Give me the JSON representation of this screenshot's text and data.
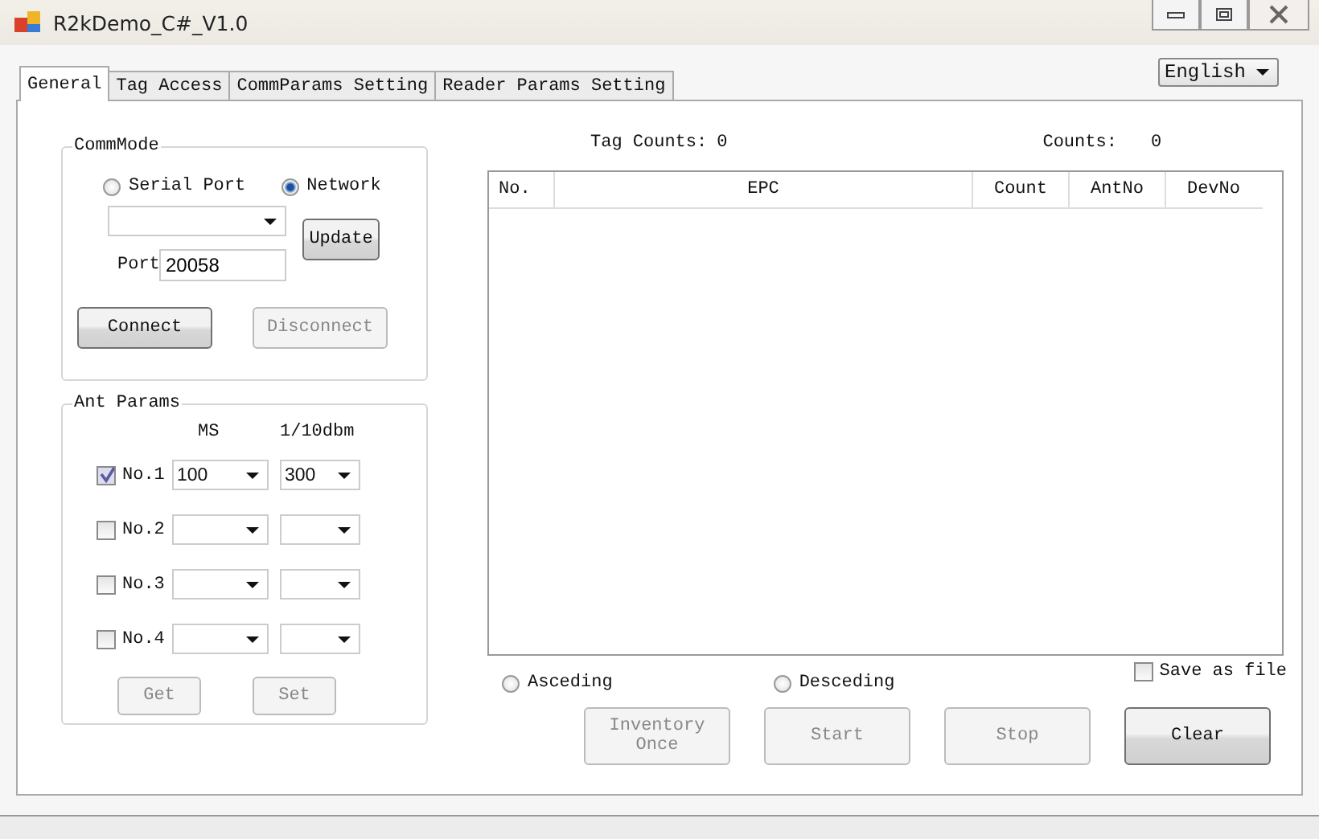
{
  "window": {
    "title": "R2kDemo_C#_V1.0"
  },
  "language": {
    "value": "English"
  },
  "tabs": [
    {
      "label": "General",
      "selected": true
    },
    {
      "label": "Tag Access",
      "selected": false
    },
    {
      "label": "CommParams Setting",
      "selected": false
    },
    {
      "label": "Reader Params Setting",
      "selected": false
    }
  ],
  "comm_mode": {
    "title": "CommMode",
    "options": [
      {
        "label": "Serial Port",
        "selected": false
      },
      {
        "label": "Network",
        "selected": true
      }
    ],
    "update_button": {
      "label": "Update",
      "disabled": false
    },
    "port_label": "Port",
    "port": "20058",
    "buttons": [
      {
        "label": "Connect",
        "disabled": false
      },
      {
        "label": "Disconnect",
        "disabled": true
      }
    ]
  },
  "ant_params": {
    "title": "Ant Params",
    "headers": [
      "MS",
      "1/10dbm"
    ],
    "antennas": [
      {
        "label": "No.1",
        "checked": true,
        "ms": "100",
        "power": "300"
      },
      {
        "label": "No.2",
        "checked": false
      },
      {
        "label": "No.3",
        "checked": false
      },
      {
        "label": "No.4",
        "checked": false
      }
    ],
    "buttons": [
      {
        "label": "Get",
        "disabled": true
      },
      {
        "label": "Set",
        "disabled": true
      }
    ]
  },
  "counts": {
    "tag_counts_label": "Tag Counts:",
    "tag_counts": "0",
    "counts_label": "Counts:",
    "counts": "0"
  },
  "table": {
    "columns": [
      "No.",
      "EPC",
      "Count",
      "AntNo",
      "DevNo"
    ]
  },
  "sort_options": [
    {
      "label": "Asceding",
      "selected": false
    },
    {
      "label": "Desceding",
      "selected": false
    }
  ],
  "save_as_file": {
    "label": "Save as file",
    "checked": false
  },
  "actions": [
    {
      "label": "Inventory Once",
      "disabled": true
    },
    {
      "label": "Start",
      "disabled": true
    },
    {
      "label": "Stop",
      "disabled": true
    },
    {
      "label": "Clear",
      "disabled": false
    }
  ]
}
